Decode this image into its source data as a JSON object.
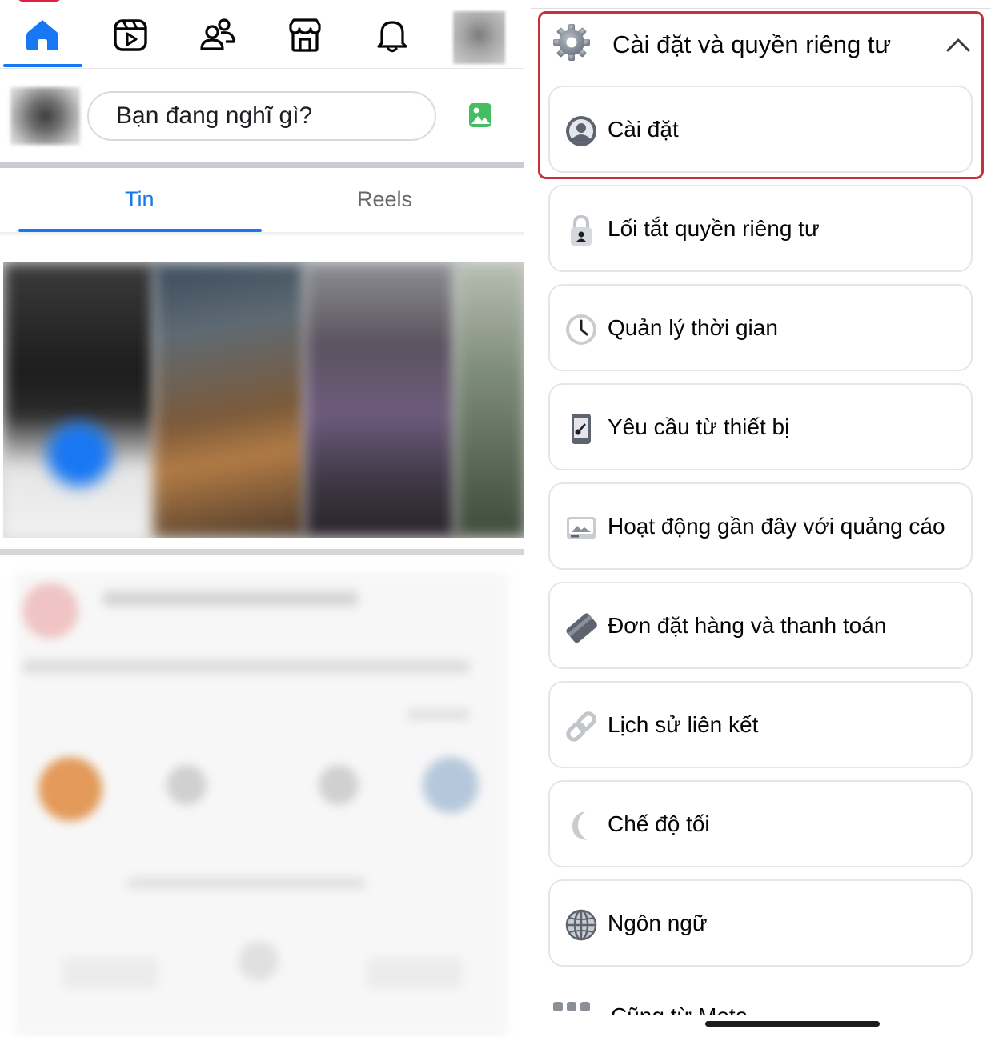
{
  "left_panel": {
    "nav": {
      "items": [
        {
          "name": "home",
          "active": true
        },
        {
          "name": "video"
        },
        {
          "name": "friends"
        },
        {
          "name": "marketplace"
        },
        {
          "name": "notifications"
        },
        {
          "name": "profile"
        }
      ]
    },
    "composer": {
      "placeholder": "Bạn đang nghĩ gì?"
    },
    "tabs": [
      {
        "label": "Tin",
        "active": true
      },
      {
        "label": "Reels",
        "active": false
      }
    ]
  },
  "right_panel": {
    "section": {
      "title": "Cài đặt và quyền riêng tư",
      "expanded": true
    },
    "menu_items": [
      {
        "label": "Cài đặt",
        "icon": "person-circle-icon"
      },
      {
        "label": "Lối tắt quyền riêng tư",
        "icon": "lock-icon"
      },
      {
        "label": "Quản lý thời gian",
        "icon": "clock-icon"
      },
      {
        "label": "Yêu cầu từ thiết bị",
        "icon": "device-icon"
      },
      {
        "label": "Hoạt động gần đây với quảng cáo",
        "icon": "ad-activity-icon"
      },
      {
        "label": "Đơn đặt hàng và thanh toán",
        "icon": "payment-card-icon"
      },
      {
        "label": "Lịch sử liên kết",
        "icon": "link-icon"
      },
      {
        "label": "Chế độ tối",
        "icon": "moon-icon"
      },
      {
        "label": "Ngôn ngữ",
        "icon": "globe-icon"
      }
    ],
    "cutoff_label": "Cũng từ Meta"
  },
  "colors": {
    "accent": "#1877f2",
    "highlight": "#c7313b",
    "text": "#050505",
    "muted": "#65676b",
    "card_border": "#e4e6eb"
  }
}
